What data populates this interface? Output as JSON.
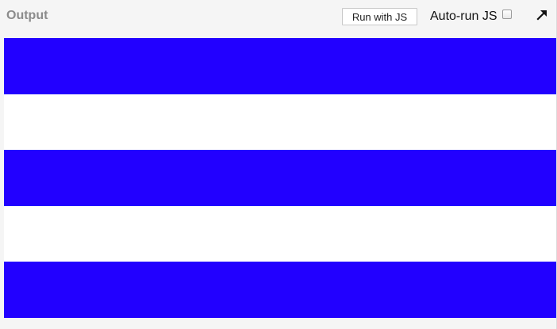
{
  "header": {
    "title": "Output",
    "run_button_label": "Run with JS",
    "autorun_label": "Auto-run JS",
    "autorun_checked": false,
    "popout_icon": "arrow-up-right-icon"
  },
  "output": {
    "stripes": [
      {
        "color": "#2200ff"
      },
      {
        "color": "#ffffff"
      },
      {
        "color": "#2200ff"
      },
      {
        "color": "#ffffff"
      },
      {
        "color": "#2200ff"
      }
    ]
  }
}
